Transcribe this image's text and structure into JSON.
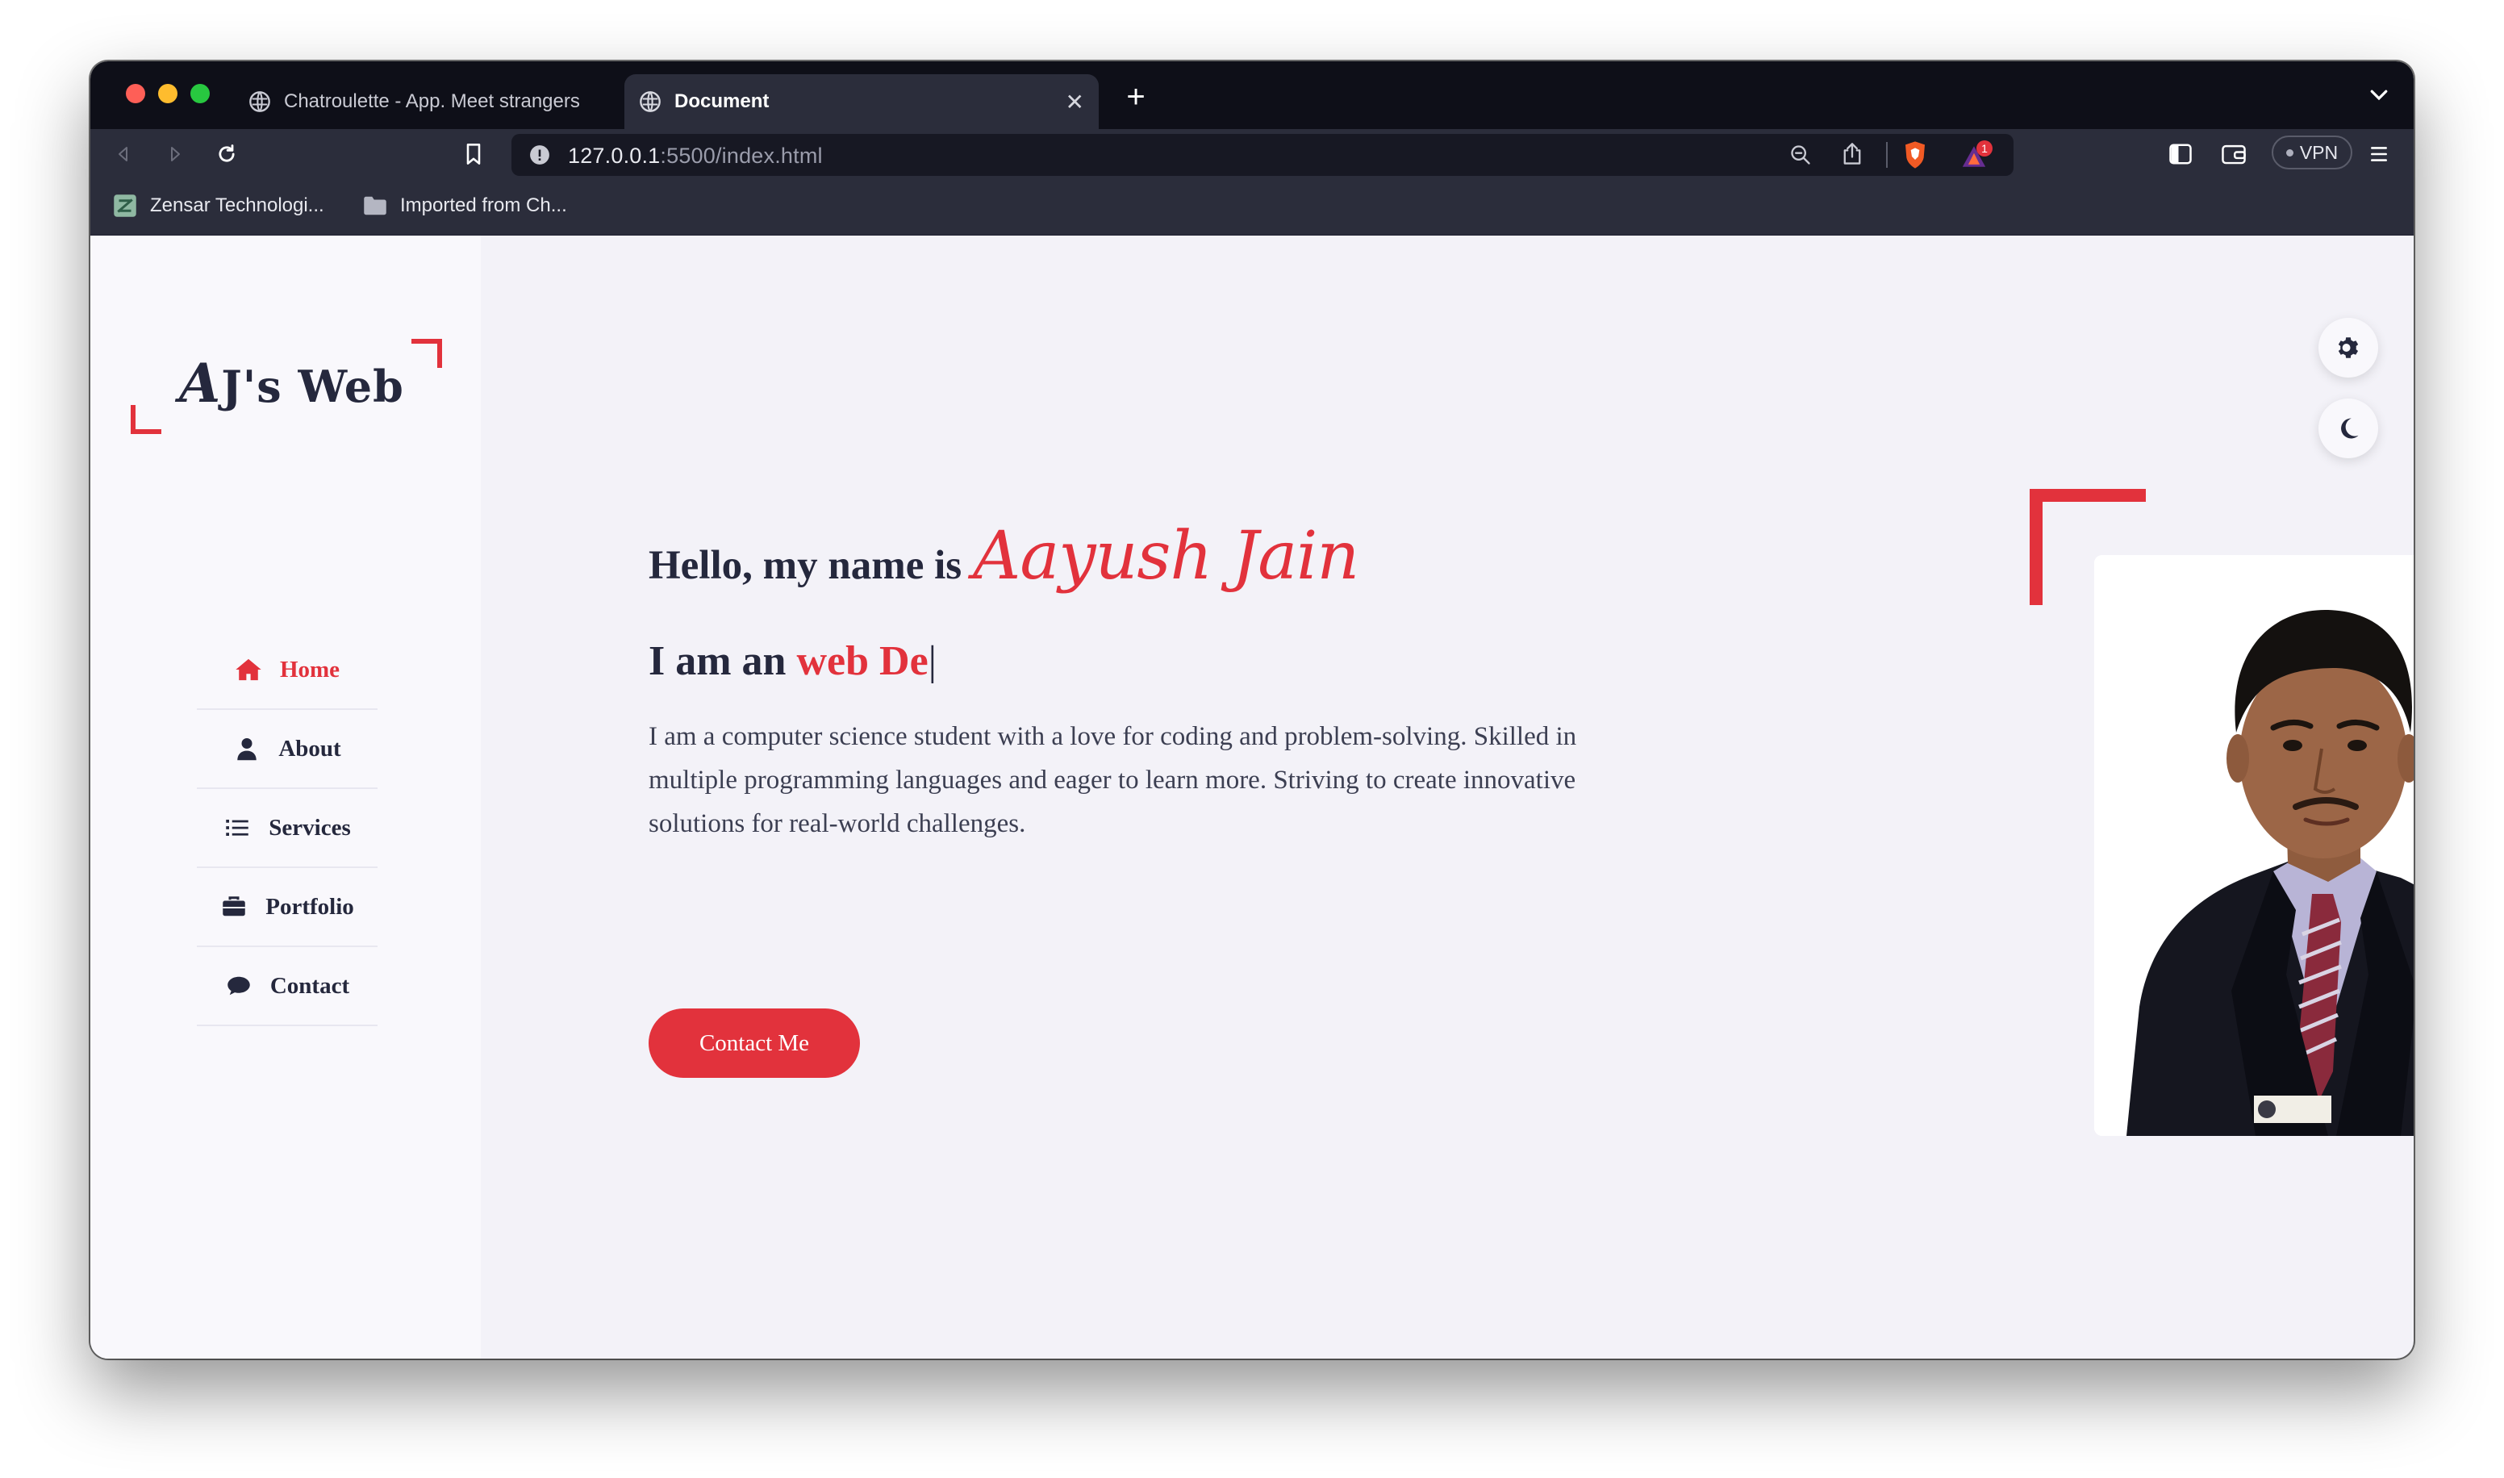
{
  "browser": {
    "tabs": [
      {
        "title": "Chatroulette - App. Meet strangers",
        "active": false
      },
      {
        "title": "Document",
        "active": true
      }
    ],
    "url": {
      "host": "127.0.0.1",
      "rest": ":5500/index.html"
    },
    "vpn_label": "VPN",
    "shield_badge": "1",
    "bookmarks": [
      {
        "label": "Zensar Technologi...",
        "icon": "site-favicon"
      },
      {
        "label": "Imported from Ch...",
        "icon": "folder-icon"
      }
    ]
  },
  "site": {
    "logo": {
      "big": "A",
      "rest": "J's Web"
    },
    "nav": [
      {
        "label": "Home",
        "icon": "home-icon",
        "active": true
      },
      {
        "label": "About",
        "icon": "user-icon",
        "active": false
      },
      {
        "label": "Services",
        "icon": "list-icon",
        "active": false
      },
      {
        "label": "Portfolio",
        "icon": "briefcase-icon",
        "active": false
      },
      {
        "label": "Contact",
        "icon": "chat-icon",
        "active": false
      }
    ],
    "hero": {
      "greeting": "Hello, my name is",
      "name": "Aayush Jain",
      "role_prefix": "I am an",
      "role_typed": "web De",
      "cursor": "|",
      "bio": "I am a computer science student with a love for coding and problem-solving. Skilled in multiple programming languages and eager to learn more. Striving to create innovative solutions for real-world challenges.",
      "cta": "Contact Me"
    },
    "colors": {
      "accent": "#e2323c",
      "text": "#25283d",
      "background": "#f3f2f8",
      "sidebar": "#f9f8fc"
    }
  }
}
